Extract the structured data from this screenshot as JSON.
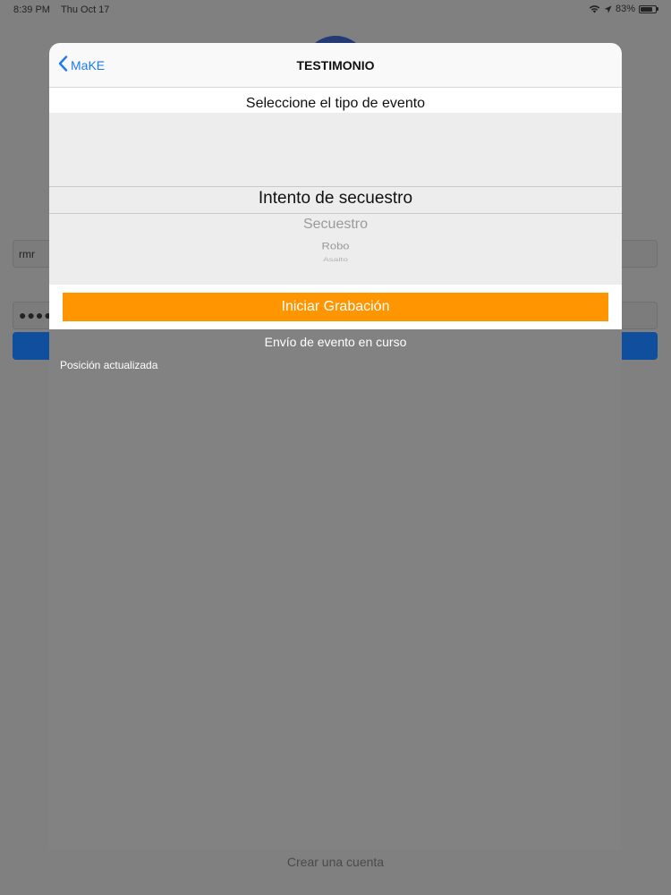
{
  "status_bar": {
    "time": "8:39 PM",
    "date": "Thu Oct 17",
    "battery": "83%",
    "battery_level": 0.83,
    "icons": [
      "wifi-icon",
      "location-arrow-icon",
      "battery-icon"
    ]
  },
  "background_screen": {
    "username_value": "rmr",
    "password_value": "●●●●●",
    "create_account_label": "Crear una cuenta",
    "login_button_color": "#0f4f9e"
  },
  "nav": {
    "back_label": "MaKE",
    "title": "TESTIMONIO"
  },
  "picker": {
    "header": "Seleccione el tipo de evento",
    "selected": "Intento de secuestro",
    "options": [
      "Secuestro",
      "Robo",
      "Asalto"
    ]
  },
  "record_button": {
    "label": "Iniciar Grabación",
    "color": "#ff9500"
  },
  "status": {
    "sending": "Envío de evento en curso",
    "position": "Posición actualizada"
  },
  "colors": {
    "accent": "#1a7cf0",
    "overlay": "#808080"
  }
}
